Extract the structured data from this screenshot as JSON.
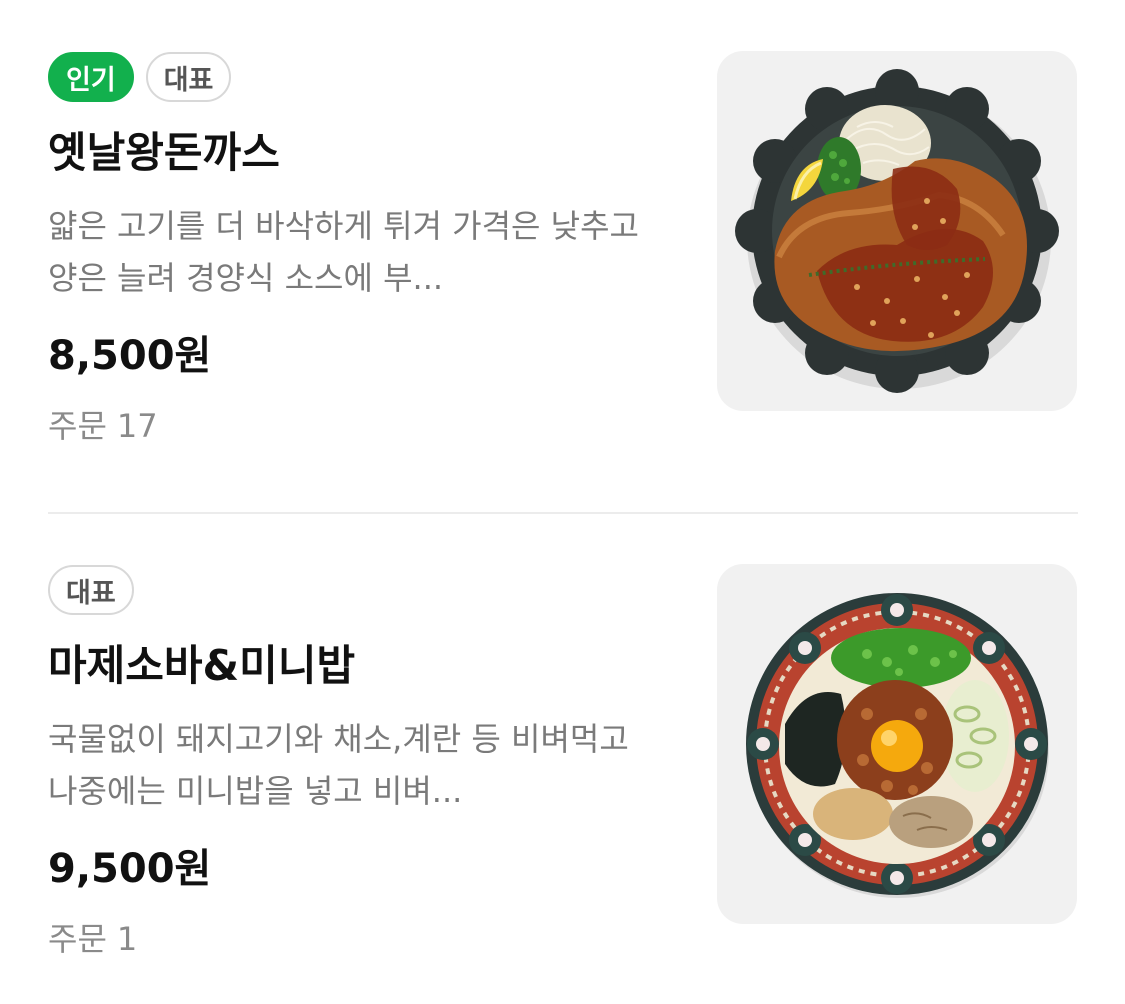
{
  "menu": {
    "items": [
      {
        "badges": [
          "인기",
          "대표"
        ],
        "name": "옛날왕돈까스",
        "description": "얇은 고기를 더 바삭하게 튀겨 가격은 낮추고 양은 늘려 경양식 소스에 부...",
        "price": "8,500원",
        "orders_label": "주문",
        "orders_count": "17",
        "image": "pork-cutlet-plate-image"
      },
      {
        "badges": [
          "대표"
        ],
        "name": "마제소바&미니밥",
        "description": "국물없이 돼지고기와 채소,계란 등 비벼먹고 나중에는 미니밥을 넣고 비벼...",
        "price": "9,500원",
        "orders_label": "주문",
        "orders_count": "1",
        "image": "mazesoba-bowl-image"
      }
    ]
  },
  "colors": {
    "popular_badge": "#12b04d",
    "badge_border": "#d8d8d8",
    "description_text": "#7a7a7a",
    "thumb_bg": "#f1f1f1"
  }
}
